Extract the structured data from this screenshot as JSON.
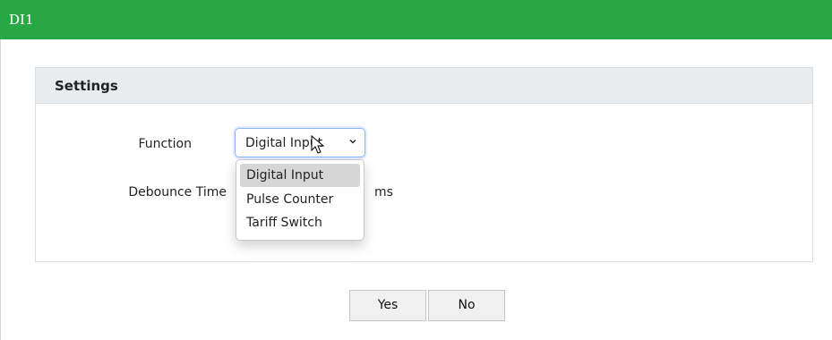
{
  "header": {
    "title": "DI1",
    "color": "#27a844"
  },
  "panel": {
    "heading": "Settings"
  },
  "form": {
    "function_label": "Function",
    "function_value": "Digital Input",
    "function_options": [
      "Digital Input",
      "Pulse Counter",
      "Tariff Switch"
    ],
    "debounce_label": "Debounce Time",
    "debounce_unit": "ms"
  },
  "buttons": {
    "yes": "Yes",
    "no": "No"
  }
}
